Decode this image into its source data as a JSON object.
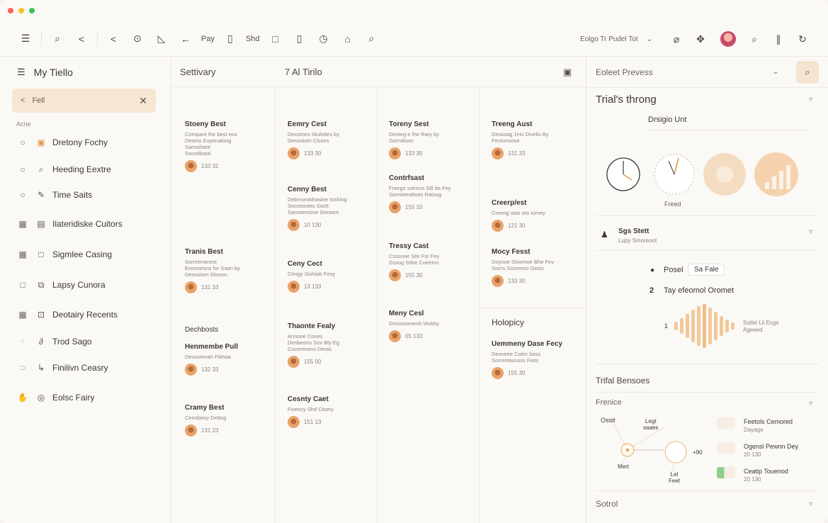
{
  "toolbar": {
    "icons": [
      "menu-icon",
      "search-icon",
      "share-icon",
      "back-arrow-icon",
      "clock-icon",
      "pen-icon",
      "left-arrow-icon",
      "document-icon",
      "square-icon",
      "trash-icon",
      "timer-icon",
      "home-icon",
      "search-icon"
    ],
    "pay_label": "Pay",
    "sho_label": "Shd",
    "dropdown_label": "Eolgo Tr Pudel Tot"
  },
  "sidebar": {
    "title": "My Tiello",
    "search_value": "Fell",
    "section_label": "Acne",
    "items": [
      {
        "label": "Dretony Fochy"
      },
      {
        "label": "Heeding Eextre"
      },
      {
        "label": "Time Saits"
      },
      {
        "label": "Ilateridiske Cuitors"
      },
      {
        "label": "Sigmlee Casing"
      },
      {
        "label": "Lapsy Cunora"
      },
      {
        "label": "Deotairy Recents"
      },
      {
        "label": "Trod Sago"
      },
      {
        "label": "Finilivn Ceasry"
      },
      {
        "label": "Eolsc Fairy"
      }
    ]
  },
  "board": {
    "col1_title": "Settivary",
    "col2_title": "7 Al Tirilo",
    "columns": [
      [
        {
          "title": "Stoeny Best",
          "desc": "Compare the best eos\nDeoms Expenalong\nSamsthant\nSocetibasti",
          "meta": "133 32"
        },
        {
          "title": "Tranis Best",
          "desc": "Sorretmanest\nEnoonesns for Saan by\nDerosiiom Gloeon",
          "meta": "131 33"
        },
        {
          "title": "Dechbosts",
          "desc": "",
          "meta": ""
        },
        {
          "title": "Henmembe Pull",
          "desc": "Deossemah Fikhaa",
          "meta": "132 33"
        },
        {
          "title": "Cramy Best",
          "desc": "Cennbeoy Dettog",
          "meta": "131 23"
        }
      ],
      [
        {
          "title": "Eemry Cest",
          "desc": "Decomes Stufoties by\nDerosiiom Cisses",
          "meta": "133 30"
        },
        {
          "title": "Cenny Best",
          "desc": "Debmorobhasker toshing\nSocetsiotes Soctt\nSamsteniose Gensert",
          "meta": "10 130"
        },
        {
          "title": "Ceny Cect",
          "desc": "Cengy Sishtab Fesy",
          "meta": "13 133"
        },
        {
          "title": "Thaonte Fealy",
          "desc": "Annooe Cooes\nDeobeons Sov Bly Eg\nCocereneos Deots",
          "meta": "155 00"
        },
        {
          "title": "Cesnty Caet",
          "desc": "Fivency Shd Cloery",
          "meta": "151 13"
        }
      ],
      [
        {
          "title": "Toreny Sest",
          "desc": "Deoteg e Ihe Rary by\nSorrstlisec",
          "meta": "133 30"
        },
        {
          "title": "Contrfsast",
          "desc": "Fnerge sotrens Sill da Fey\nSorrsteesfoots Ratsog",
          "meta": "155 33"
        },
        {
          "title": "Tressy Cast",
          "desc": "Csssnoe Sile Fsr Fey\nDssog Sitbe Coeems",
          "meta": "155 30"
        },
        {
          "title": "Meny Cesl",
          "desc": "Drossoomesh Wobsy",
          "meta": "05 133"
        }
      ],
      [
        {
          "title": "Treeng Aust",
          "desc": "Deossag 1Hu Divelis By\nFentorniose",
          "meta": "131 33"
        },
        {
          "title": "Creerp/est",
          "desc": "Creeng stoe eto tomey",
          "meta": "121 30"
        },
        {
          "title": "Mocy Fesst",
          "desc": "Doynoe Stoomoe Bhe Fey\nSocrs Ssomeso Geiss",
          "meta": "133 30"
        },
        {
          "title": "Holopicy",
          "desc": "",
          "meta": ""
        },
        {
          "title": "Uemmeny Dase Fecy",
          "desc": "Deoveee Colec bass\nSorreetasnsss Fiots",
          "meta": "155 30"
        }
      ]
    ]
  },
  "right": {
    "header_label": "Eoleet Prevess",
    "section1_title": "Trial's throng",
    "section1_sub": "Drsigio Unt",
    "gauge_caption": "Freed",
    "row2_title": "Sgs Stett",
    "row2_sub": "Lupy Smoreoot",
    "item1_label": "Posel",
    "item1_tag": "Sa Fale",
    "item2_num": "2",
    "item2_label": "Tay efeomol Oromet",
    "wave_left": "1",
    "wave_right": "Sotlel Lil Ecge\nAgeeed",
    "section3_title": "Trifal Bensoes",
    "section4_title": "Frenice",
    "flow": {
      "a": "Ossit",
      "b": "Legt\nsaaes",
      "c": "Mert",
      "d": "Lel\nFeet",
      "e": "+90"
    },
    "legend": [
      {
        "label": "Feetols Cemored",
        "sub": "Dayage"
      },
      {
        "label": "Ogensl Pewnn Dey",
        "sub": "20 130"
      },
      {
        "label": "Ceatip Touenod",
        "sub": "20 130"
      }
    ],
    "section5_title": "Sotrol"
  },
  "colors": {
    "accent": "#f0c79c",
    "accent_soft": "#f6e6d2",
    "green": "#8fcf8d",
    "red": "#ff5f56",
    "yellow": "#ffbd2e"
  }
}
